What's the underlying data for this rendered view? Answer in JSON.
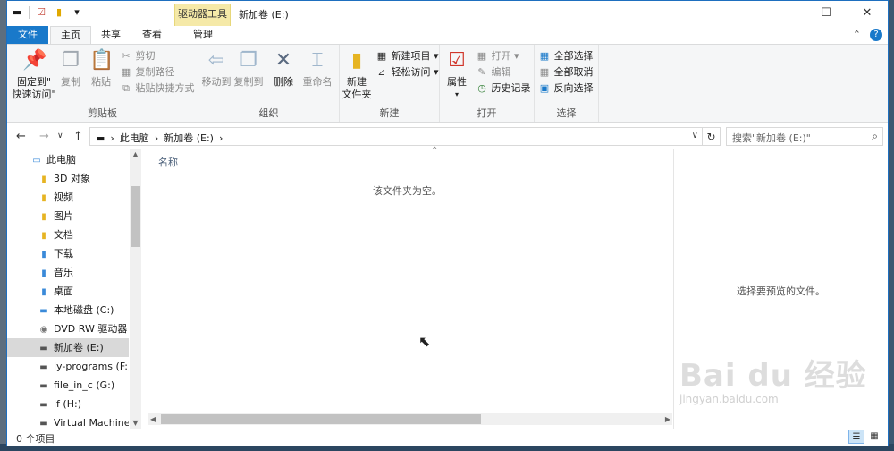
{
  "titlebar": {
    "drive_tools_tab": "驱动器工具",
    "title": "新加卷 (E:)",
    "minimize": "—",
    "maximize": "☐",
    "close": "✕"
  },
  "tabs": {
    "file": "文件",
    "home": "主页",
    "share": "共享",
    "view": "查看",
    "manage": "管理"
  },
  "ribbon": {
    "clipboard": {
      "label": "剪贴板",
      "pin": "固定到\"\n快速访问\"",
      "pin_line1": "固定到\"",
      "pin_line2": "快速访问\"",
      "copy": "复制",
      "paste": "粘贴",
      "cut": "剪切",
      "copy_path": "复制路径",
      "paste_shortcut": "粘贴快捷方式"
    },
    "organize": {
      "label": "组织",
      "move_to": "移动到",
      "copy_to": "复制到",
      "delete": "删除",
      "rename": "重命名"
    },
    "new": {
      "label": "新建",
      "new_folder_line1": "新建",
      "new_folder_line2": "文件夹",
      "new_item": "新建项目",
      "easy_access": "轻松访问"
    },
    "open": {
      "label": "打开",
      "properties": "属性",
      "open": "打开",
      "edit": "编辑",
      "history": "历史记录"
    },
    "select": {
      "label": "选择",
      "select_all": "全部选择",
      "select_none": "全部取消",
      "invert": "反向选择"
    }
  },
  "address": {
    "crumb1": "此电脑",
    "crumb2": "新加卷 (E:)",
    "search_placeholder": "搜索\"新加卷 (E:)\""
  },
  "nav": {
    "items": [
      {
        "label": "此电脑",
        "icon": "computer-icon"
      },
      {
        "label": "3D 对象",
        "icon": "folder-3d-icon"
      },
      {
        "label": "视频",
        "icon": "folder-video-icon"
      },
      {
        "label": "图片",
        "icon": "folder-pictures-icon"
      },
      {
        "label": "文档",
        "icon": "folder-documents-icon"
      },
      {
        "label": "下载",
        "icon": "folder-downloads-icon"
      },
      {
        "label": "音乐",
        "icon": "folder-music-icon"
      },
      {
        "label": "桌面",
        "icon": "folder-desktop-icon"
      },
      {
        "label": "本地磁盘 (C:)",
        "icon": "drive-icon"
      },
      {
        "label": "DVD RW 驱动器 (",
        "icon": "dvd-drive-icon"
      },
      {
        "label": "新加卷 (E:)",
        "icon": "drive-icon"
      },
      {
        "label": "ly-programs (F:)",
        "icon": "drive-icon"
      },
      {
        "label": "file_in_c (G:)",
        "icon": "drive-icon"
      },
      {
        "label": "lf (H:)",
        "icon": "drive-icon"
      },
      {
        "label": "Virtual Machines",
        "icon": "drive-icon"
      }
    ]
  },
  "content": {
    "column_name": "名称",
    "empty_message": "该文件夹为空。"
  },
  "preview": {
    "message": "选择要预览的文件。"
  },
  "status": {
    "item_count": "0 个项目"
  },
  "watermark": {
    "brand": "Bai du 经验",
    "url": "jingyan.baidu.com"
  },
  "colors": {
    "accent": "#1979ca",
    "tools_tab": "#f5e9a8",
    "selected_nav": "#d9d9d9"
  }
}
